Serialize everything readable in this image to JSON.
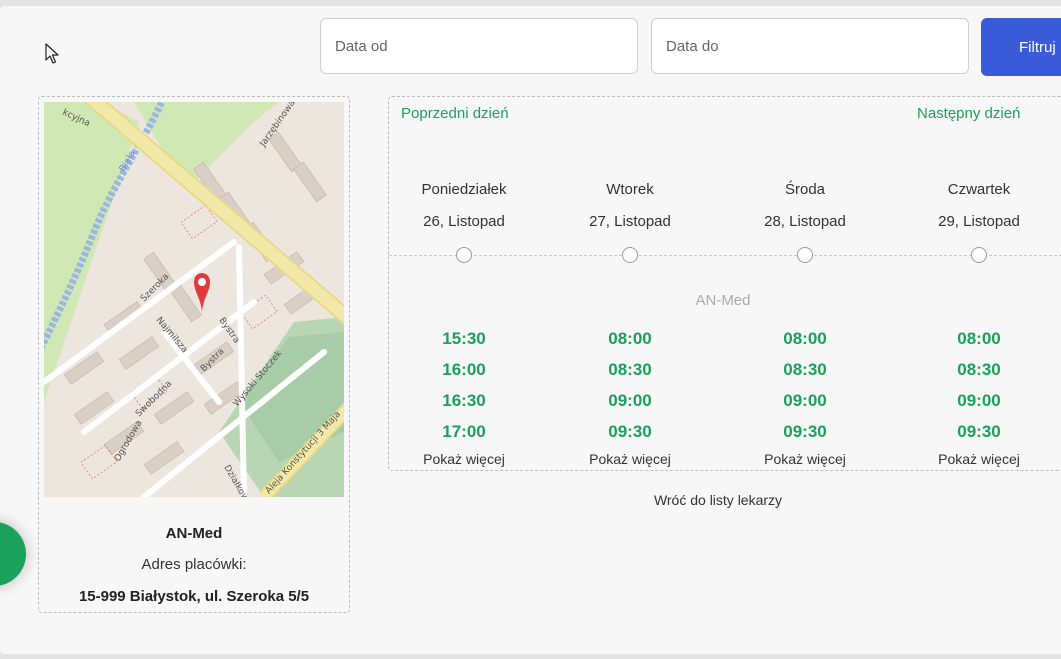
{
  "filters": {
    "date_from_placeholder": "Data od",
    "date_to_placeholder": "Data do",
    "filter_label": "Filtruj"
  },
  "clinic": {
    "name": "AN-Med",
    "address_label": "Adres placówki:",
    "address": "15-999 Białystok, ul. Szeroka 5/5",
    "map_labels": {
      "river": "Biała",
      "street_top_left": "kcyjna",
      "street_top_right": "Jarzębinowa",
      "street_1": "Szeroka",
      "street_2": "Najmilsza",
      "street_3": "Bystra",
      "street_4": "Bystra",
      "street_5": "Swobodna",
      "street_6": "Wysoki Stoczek",
      "street_7": "Ogrodowa",
      "street_8": "Działkowa",
      "street_9": "Aleja Konstytucji 3 Maja"
    },
    "marker_color": "#e03a3a"
  },
  "schedule": {
    "prev_day": "Poprzedni dzień",
    "next_day": "Następny dzień",
    "provider": "AN-Med",
    "show_more": "Pokaż więcej",
    "days": [
      {
        "name": "Poniedziałek",
        "date": "26, Listopad",
        "slots": [
          "15:30",
          "16:00",
          "16:30",
          "17:00"
        ]
      },
      {
        "name": "Wtorek",
        "date": "27, Listopad",
        "slots": [
          "08:00",
          "08:30",
          "09:00",
          "09:30"
        ]
      },
      {
        "name": "Środa",
        "date": "28, Listopad",
        "slots": [
          "08:00",
          "08:30",
          "09:00",
          "09:30"
        ]
      },
      {
        "name": "Czwartek",
        "date": "29, Listopad",
        "slots": [
          "08:00",
          "08:30",
          "09:00",
          "09:30"
        ]
      }
    ],
    "accent_color": "#1aa15b"
  },
  "footer": {
    "back_link": "Wróć do listy lekarzy"
  }
}
